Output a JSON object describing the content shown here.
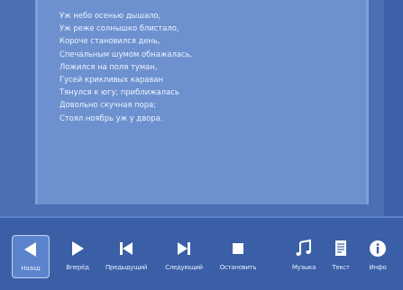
{
  "poem": {
    "lines": [
      "Уж небо осенью дышало,",
      "Уж реже солнышко блистало,",
      "Короче становился день,",
      "Спечальным шумом обнажалась,",
      "Ложился на поля туман,",
      "Гусей крикливых караван",
      "Тянулся к югу; приближалась",
      "Довольно скучная пора;",
      "Стоял ноябрь уж у двора."
    ]
  },
  "toolbar": {
    "buttons": [
      {
        "label": "Назад",
        "icon": "arrow-left-icon"
      },
      {
        "label": "Вперёд",
        "icon": "arrow-right-icon"
      },
      {
        "label": "Предыдущий",
        "icon": "skip-previous-icon"
      },
      {
        "label": "Следующий",
        "icon": "skip-next-icon"
      },
      {
        "label": "Остановить",
        "icon": "stop-icon"
      },
      {
        "label": "Музыка",
        "icon": "music-note-icon"
      },
      {
        "label": "Текст",
        "icon": "document-icon"
      },
      {
        "label": "Инфо",
        "icon": "info-icon"
      }
    ],
    "active_index": 0
  }
}
